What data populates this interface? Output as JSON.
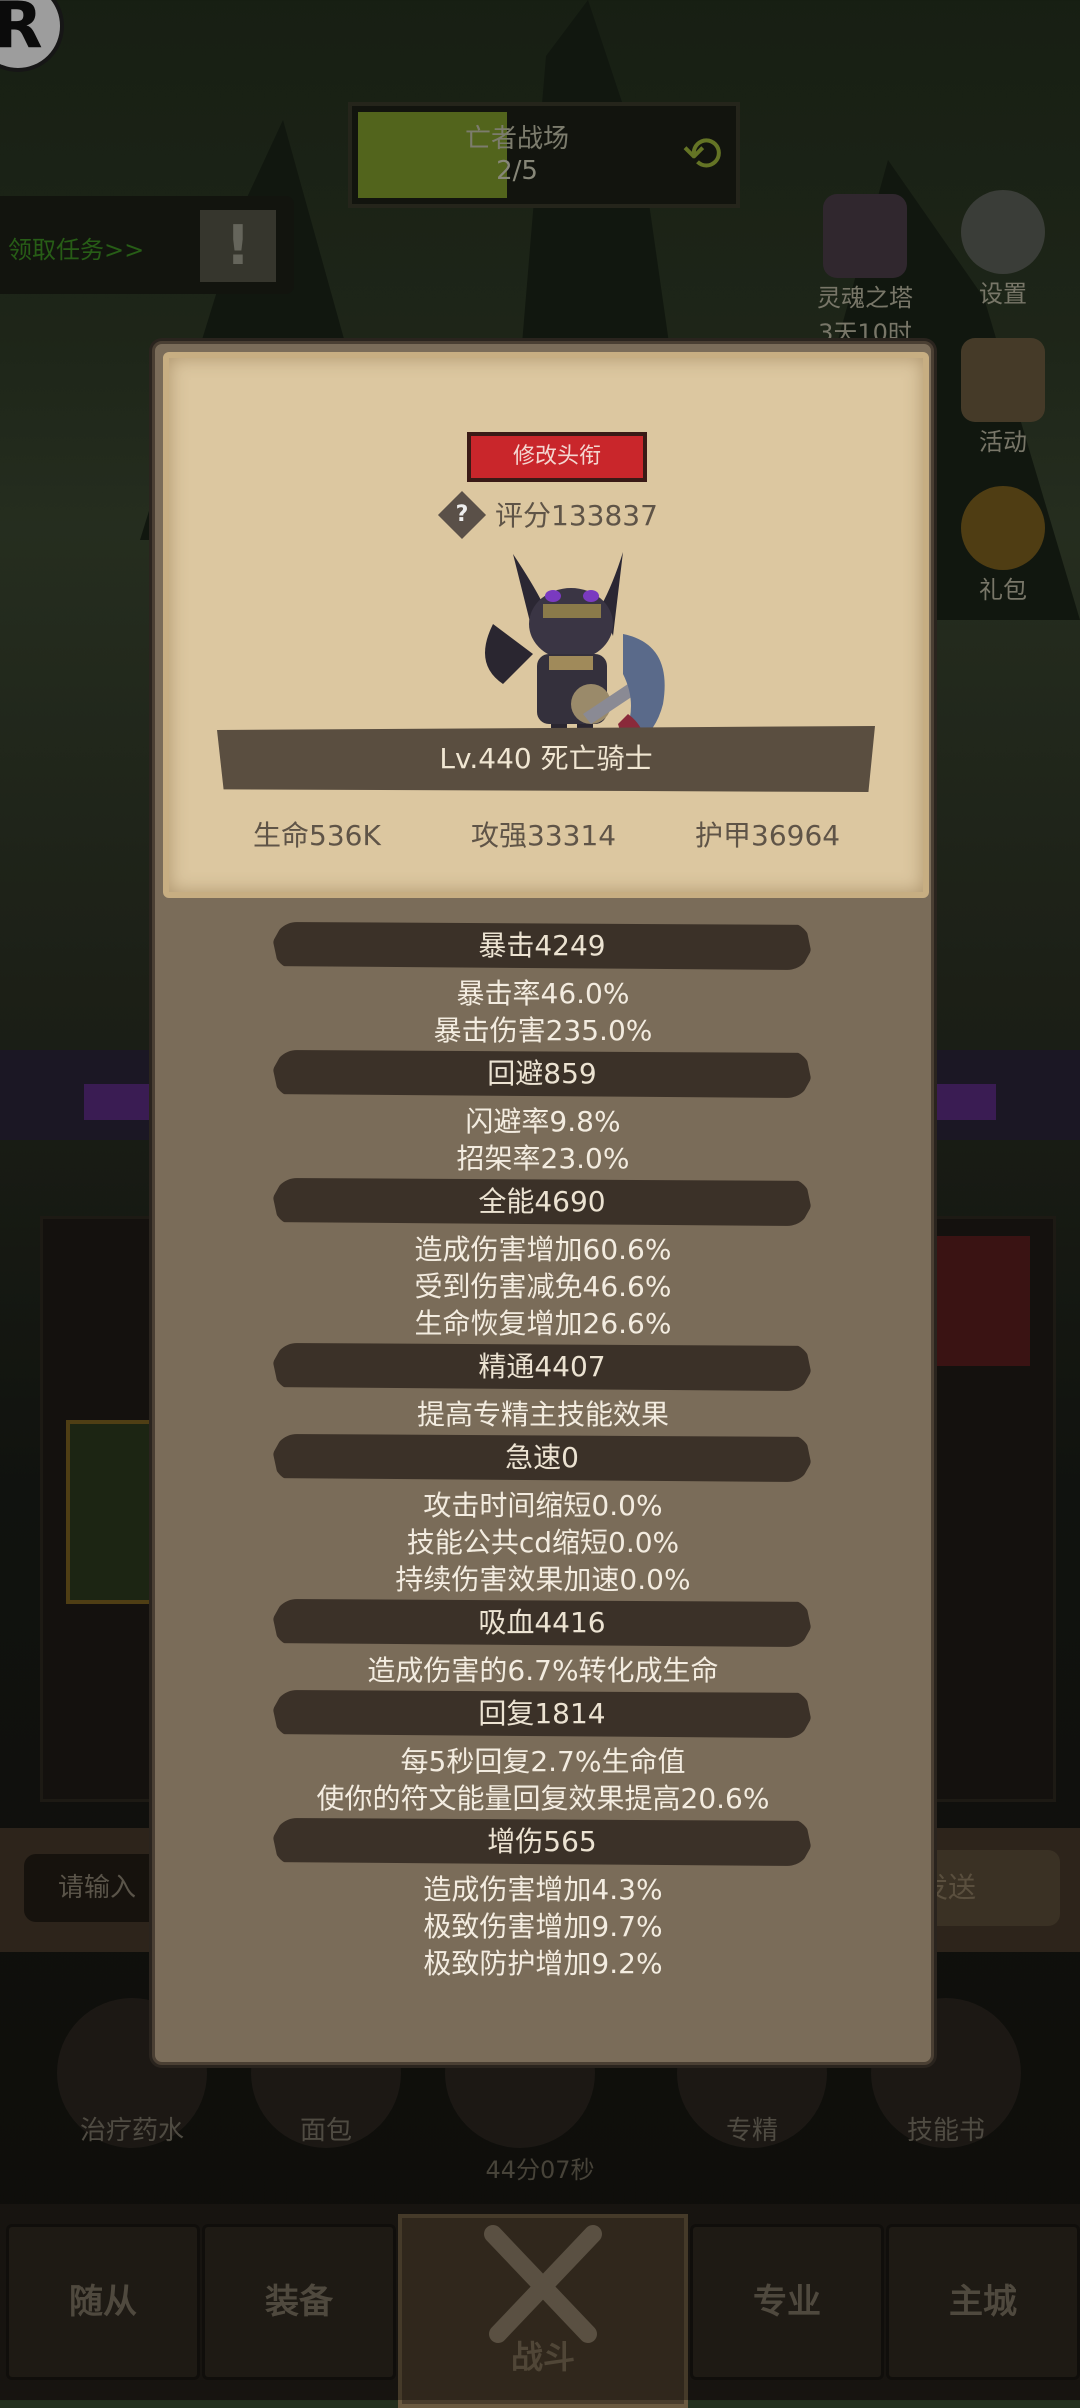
{
  "top": {
    "stage_title": "亡者战场",
    "stage_progress": "2/5",
    "stage_progress_fraction": 0.4,
    "quest_label": "领取任务>>"
  },
  "side_menu": [
    {
      "label": "灵魂之塔",
      "sub": "3天10时",
      "icon": "tower-icon"
    },
    {
      "label": "设置",
      "icon": "gear-icon"
    },
    {
      "label": "活动",
      "icon": "scroll-icon"
    },
    {
      "label": "礼包",
      "icon": "gift-icon"
    }
  ],
  "profile": {
    "title_button": "修改头衔",
    "score": "评分133837",
    "level_name": "Lv.440 死亡骑士",
    "stats": [
      "生命536K",
      "攻强33314",
      "护甲36964"
    ]
  },
  "sections": [
    {
      "title": "暴击4249",
      "lines": [
        "暴击率46.0%",
        "暴击伤害235.0%"
      ]
    },
    {
      "title": "回避859",
      "lines": [
        "闪避率9.8%",
        "招架率23.0%"
      ]
    },
    {
      "title": "全能4690",
      "lines": [
        "造成伤害增加60.6%",
        "受到伤害减免46.6%",
        "生命恢复增加26.6%"
      ]
    },
    {
      "title": "精通4407",
      "lines": [
        "提高专精主技能效果"
      ]
    },
    {
      "title": "急速0",
      "lines": [
        "攻击时间缩短0.0%",
        "技能公共cd缩短0.0%",
        "持续伤害效果加速0.0%"
      ]
    },
    {
      "title": "吸血4416",
      "lines": [
        "造成伤害的6.7%转化成生命"
      ]
    },
    {
      "title": "回复1814",
      "lines": [
        "每5秒回复2.7%生命值",
        "使你的符文能量回复效果提高20.6%"
      ]
    },
    {
      "title": "增伤565",
      "lines": [
        "造成伤害增加4.3%",
        "极致伤害增加9.7%",
        "极致防护增加9.2%"
      ]
    }
  ],
  "chat": {
    "placeholder": "请输入",
    "send": "发送"
  },
  "items": [
    "治疗药水",
    "面包",
    "",
    "专精",
    "技能书"
  ],
  "timer": "44分07秒",
  "nav": {
    "companions": "随从",
    "equipment": "装备",
    "battle": "战斗",
    "profession": "专业",
    "main_city": "主城"
  }
}
